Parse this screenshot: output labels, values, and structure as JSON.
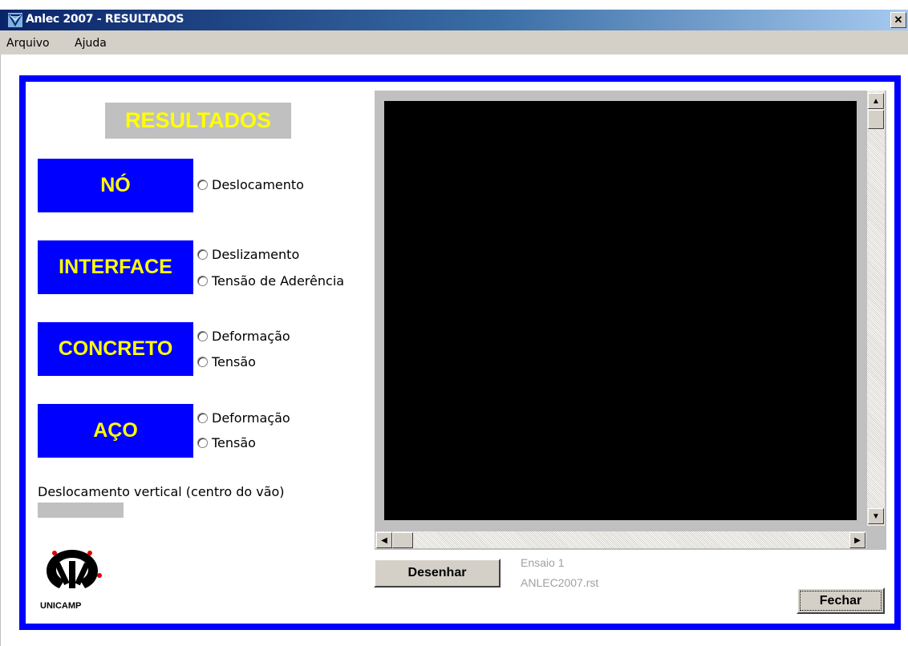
{
  "window": {
    "title": "Anlec 2007 - RESULTADOS",
    "close_glyph": "✕"
  },
  "menu": {
    "items": [
      "Arquivo",
      "Ajuda"
    ]
  },
  "panel": {
    "header": "RESULTADOS",
    "categories": [
      {
        "label": "NÓ",
        "options": [
          "Deslocamento"
        ]
      },
      {
        "label": "INTERFACE",
        "options": [
          "Deslizamento",
          "Tensão de Aderência"
        ]
      },
      {
        "label": "CONCRETO",
        "options": [
          "Deformação",
          "Tensão"
        ]
      },
      {
        "label": "AÇO",
        "options": [
          "Deformação",
          "Tensão"
        ]
      }
    ],
    "vertical_displacement_label": "Deslocamento vertical (centro do vão)",
    "vertical_displacement_value": ""
  },
  "logo": {
    "text": "UNICAMP",
    "icon": "unicamp-logo-icon"
  },
  "canvas": {
    "background": "#000000"
  },
  "actions": {
    "draw_label": "Desenhar",
    "close_label": "Fechar"
  },
  "info": {
    "test_name": "Ensaio 1",
    "file_name": "ANLEC2007.rst"
  },
  "colors": {
    "frame": "#0000ff",
    "category_bg": "#0000ff",
    "category_text": "#ffff00",
    "header_bg": "#c0c0c0"
  }
}
